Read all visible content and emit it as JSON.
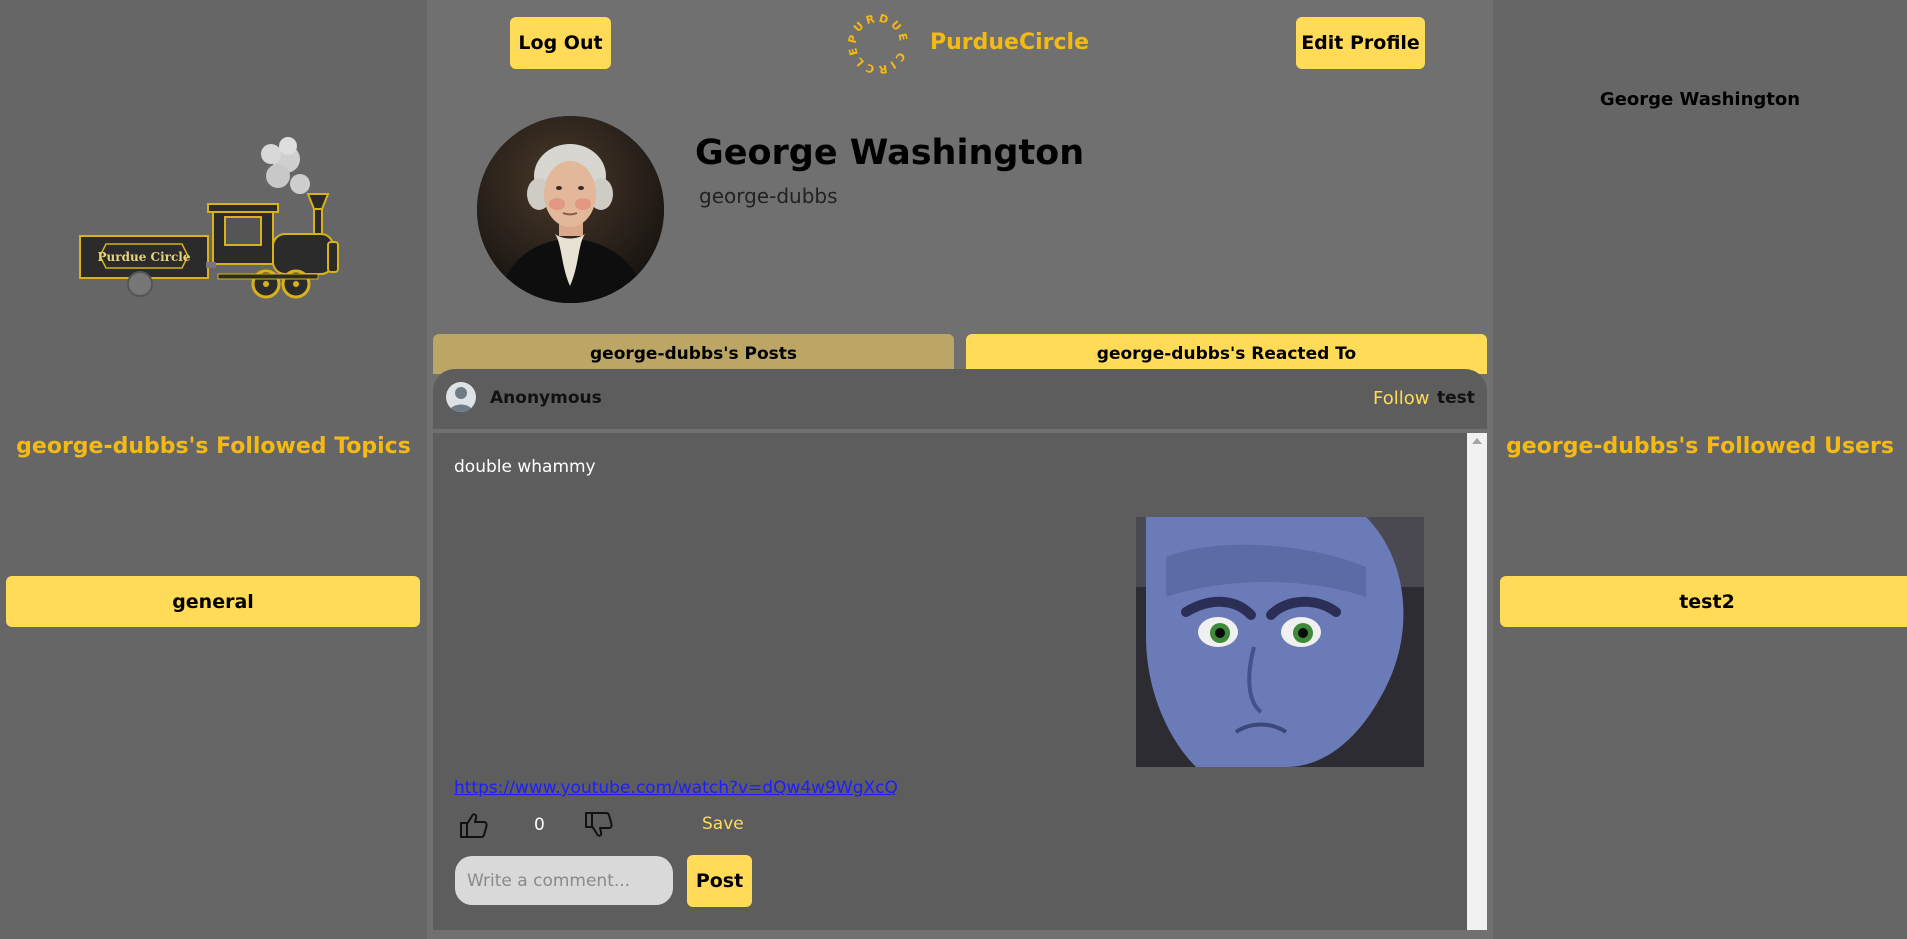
{
  "header": {
    "logout_label": "Log Out",
    "app_name": "PurdueCircle",
    "logo_ring_text": "PURDUE CIRCLE",
    "edit_profile_label": "Edit Profile"
  },
  "profile": {
    "display_name": "George Washington",
    "username": "george-dubbs"
  },
  "tabs": [
    {
      "label": "george-dubbs's Posts",
      "active": true
    },
    {
      "label": "george-dubbs's Reacted To",
      "active": false
    }
  ],
  "post": {
    "author": "Anonymous",
    "follow_label": "Follow",
    "topic": "test",
    "text": "double whammy",
    "link": "https://www.youtube.com/watch?v=dQw4w9WgXcQ",
    "like_count": "0",
    "save_label": "Save",
    "comment_placeholder": "Write a comment...",
    "post_button_label": "Post"
  },
  "left_panel": {
    "train_sign_text": "Purdue Circle",
    "followed_topics_title": "george-dubbs's Followed Topics",
    "topics": [
      "general"
    ]
  },
  "right_panel": {
    "name": "George Washington",
    "followed_users_title": "george-dubbs's Followed Users",
    "users": [
      "test2"
    ]
  },
  "colors": {
    "accent": "#ffdb58",
    "title_gold": "#f5b914",
    "background": "#666666",
    "center_background": "#707070",
    "post_background": "#5d5d5d",
    "inactive_tab": "#bca665"
  }
}
